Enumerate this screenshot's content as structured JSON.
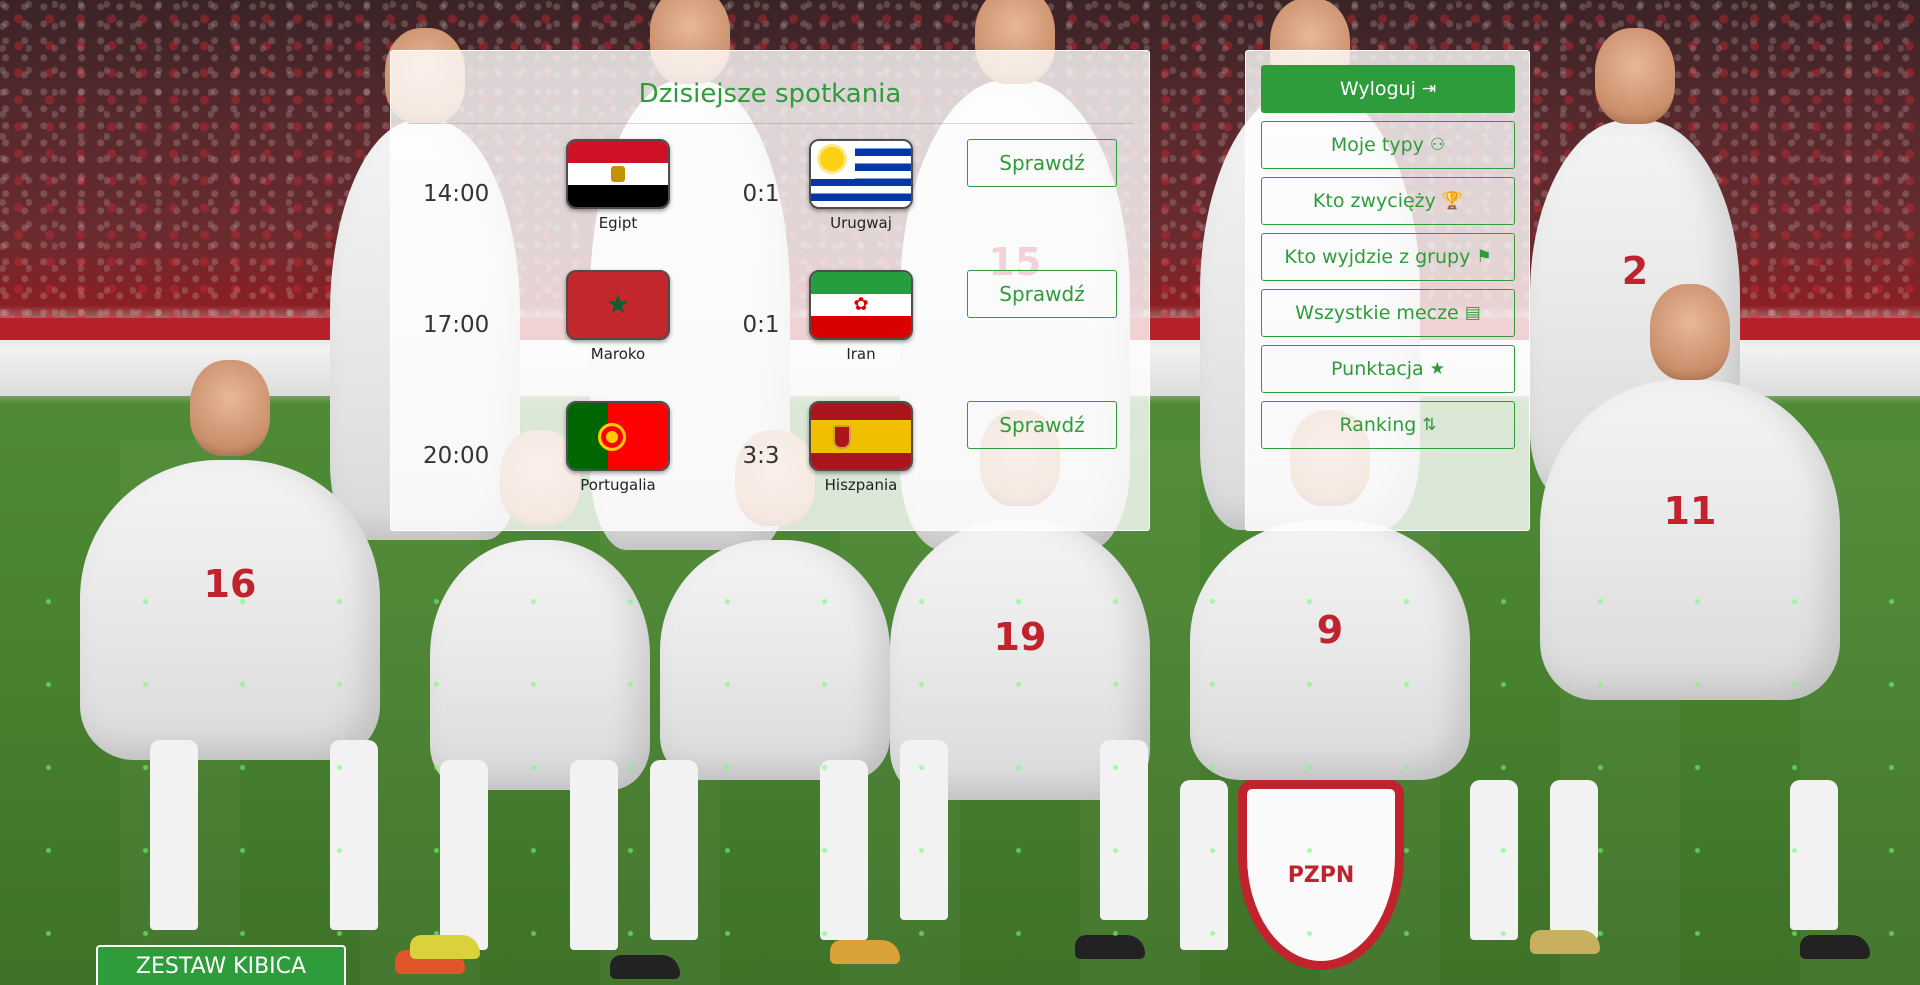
{
  "today": {
    "title": "Dzisiejsze spotkania",
    "check_label": "Sprawdź",
    "matches": [
      {
        "time": "14:00",
        "home": "Egipt",
        "score": "0:1",
        "away": "Urugwaj"
      },
      {
        "time": "17:00",
        "home": "Maroko",
        "score": "0:1",
        "away": "Iran"
      },
      {
        "time": "20:00",
        "home": "Portugalia",
        "score": "3:3",
        "away": "Hiszpania"
      }
    ]
  },
  "menu": {
    "items": [
      {
        "label": "Wyloguj",
        "icon": "sign-out-icon",
        "glyph": "⇥"
      },
      {
        "label": "Moje typy",
        "icon": "user-desk-icon",
        "glyph": "⚇"
      },
      {
        "label": "Kto zwycięży",
        "icon": "trophy-icon",
        "glyph": "🏆"
      },
      {
        "label": "Kto wyjdzie z grupy",
        "icon": "door-exit-icon",
        "glyph": "⚑"
      },
      {
        "label": "Wszystkie mecze",
        "icon": "list-alt-icon",
        "glyph": "▤"
      },
      {
        "label": "Punktacja",
        "icon": "star-icon",
        "glyph": "★"
      },
      {
        "label": "Ranking",
        "icon": "sort-numeric-icon",
        "glyph": "⇅"
      }
    ]
  },
  "footer": {
    "fan_kit_label": "ZESTAW KIBICA"
  },
  "colors": {
    "accent": "#2e9c3a"
  }
}
